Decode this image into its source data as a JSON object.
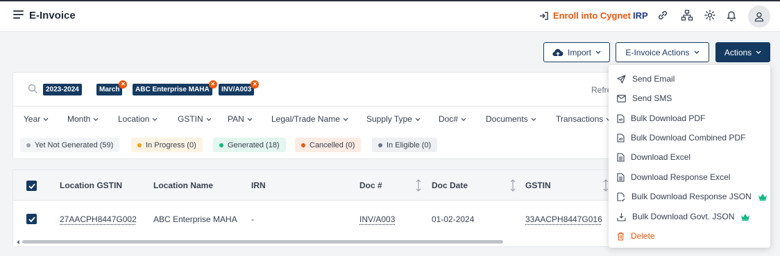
{
  "header": {
    "title": "E-Invoice",
    "enroll_text_1": "Enroll into Cygnet",
    "enroll_text_2": "IRP",
    "icons": [
      "menu-icon",
      "link-icon",
      "sitemap-icon",
      "gear-icon",
      "bell-icon",
      "user-icon"
    ]
  },
  "toolbar": {
    "import_label": "Import",
    "einvoice_actions_label": "E-Invoice Actions",
    "actions_label": "Actions"
  },
  "filters": {
    "chips": [
      "2023-2024",
      "March",
      "ABC Enterprise MAHA",
      "INV/A003"
    ],
    "refresh_label": "Refre",
    "columns": [
      "Year",
      "Month",
      "Location",
      "GSTIN",
      "PAN",
      "Legal/Trade Name",
      "Supply Type",
      "Doc#",
      "Documents",
      "Transactions"
    ],
    "statuses": [
      {
        "label": "Yet Not Generated (59)",
        "dot": "#9ca3af",
        "bg": "#f3f4f6"
      },
      {
        "label": "In Progress (0)",
        "dot": "#f59e0b",
        "bg": "#fdf3e3"
      },
      {
        "label": "Generated (18)",
        "dot": "#10b981",
        "bg": "#e3f6ef"
      },
      {
        "label": "Cancelled (0)",
        "dot": "#ea580c",
        "bg": "#fdece4"
      },
      {
        "label": "In Eligible (0)",
        "dot": "#64748b",
        "bg": "#eef0f3"
      }
    ]
  },
  "table": {
    "columns": [
      "Location GSTIN",
      "Location Name",
      "IRN",
      "Doc #",
      "Doc Date",
      "GSTIN"
    ],
    "rows": [
      {
        "location_gstin": "27AACPH8447G002",
        "location_name": "ABC Enterprise MAHA",
        "irn": "-",
        "doc_no": "INV/A003",
        "doc_date": "01-02-2024",
        "gstin": "33AACPH8447G016"
      }
    ]
  },
  "actions_menu": {
    "items": [
      {
        "label": "Send Email",
        "icon": "send-icon"
      },
      {
        "label": "Send SMS",
        "icon": "envelope-icon"
      },
      {
        "label": "Bulk Download PDF",
        "icon": "pdf-file-icon"
      },
      {
        "label": "Bulk Download Combined PDF",
        "icon": "pdf-file-icon"
      },
      {
        "label": "Download Excel",
        "icon": "excel-file-icon"
      },
      {
        "label": "Download Response Excel",
        "icon": "excel-file-icon"
      },
      {
        "label": "Bulk Download Response JSON",
        "icon": "json-file-icon",
        "premium": true
      },
      {
        "label": "Bulk Download Govt. JSON",
        "icon": "download-tray-icon",
        "premium": true
      },
      {
        "label": "Delete",
        "icon": "trash-icon",
        "danger": true
      }
    ]
  },
  "colors": {
    "primary": "#153a61",
    "accent": "#ea580c",
    "premium": "#10b981"
  }
}
